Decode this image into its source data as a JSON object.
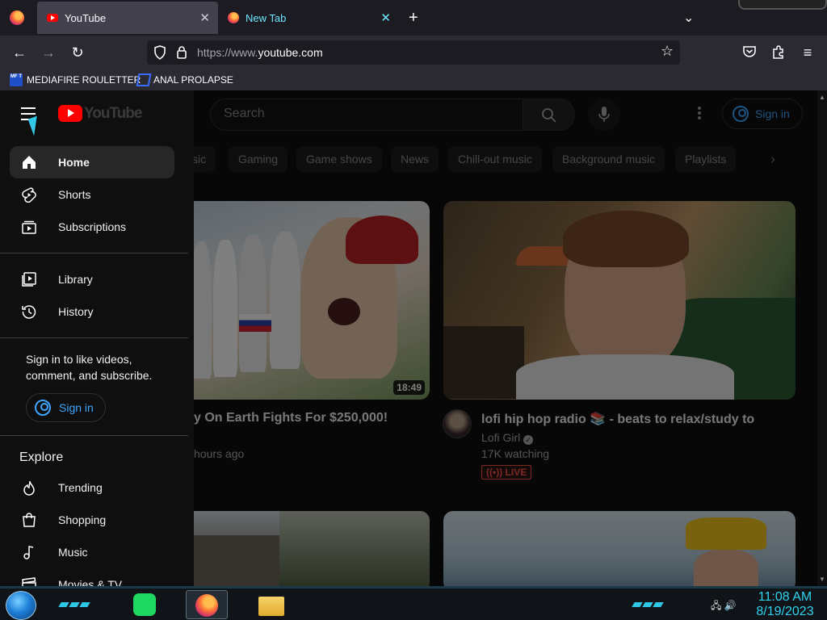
{
  "browser": {
    "tabs": [
      {
        "title": "YouTube",
        "active": true
      },
      {
        "title": "New Tab",
        "active": false
      }
    ],
    "url": {
      "prefix": "https://www.",
      "domain": "youtube.com"
    },
    "bookmarks": [
      {
        "label": "MEDIAFIRE ROULETTER",
        "icon_text": "MF T"
      },
      {
        "label": "ANAL PROLAPSE"
      }
    ]
  },
  "masthead": {
    "logo_text": "YouTube",
    "search_placeholder": "Search",
    "signin_label": "Sign in"
  },
  "chips": [
    "sic",
    "Gaming",
    "Game shows",
    "News",
    "Chill-out music",
    "Background music",
    "Playlists"
  ],
  "videos": [
    {
      "title": "y On Earth Fights For $250,000!",
      "meta": "hours ago",
      "duration": "18:49"
    },
    {
      "title": "lofi hip hop radio 📚 - beats to relax/study to",
      "channel": "Lofi Girl",
      "meta": "17K watching",
      "badge": "LIVE"
    }
  ],
  "sidebar": {
    "main": [
      {
        "label": "Home",
        "icon": "home-icon"
      },
      {
        "label": "Shorts",
        "icon": "shorts-icon"
      },
      {
        "label": "Subscriptions",
        "icon": "subscriptions-icon"
      }
    ],
    "you": [
      {
        "label": "Library",
        "icon": "library-icon"
      },
      {
        "label": "History",
        "icon": "history-icon"
      }
    ],
    "signin_prompt": "Sign in to like videos, comment, and subscribe.",
    "signin_label": "Sign in",
    "explore_heading": "Explore",
    "explore": [
      {
        "label": "Trending",
        "icon": "trending-icon"
      },
      {
        "label": "Shopping",
        "icon": "shopping-icon"
      },
      {
        "label": "Music",
        "icon": "music-icon"
      },
      {
        "label": "Movies & TV",
        "icon": "movies-icon"
      }
    ]
  },
  "taskbar": {
    "time": "11:08 AM",
    "date": "8/19/2023"
  },
  "colors": {
    "accent": "#3ea6ff",
    "live": "#ff4e45",
    "yt_red": "#ff0000",
    "clock": "#2fd3f0"
  }
}
